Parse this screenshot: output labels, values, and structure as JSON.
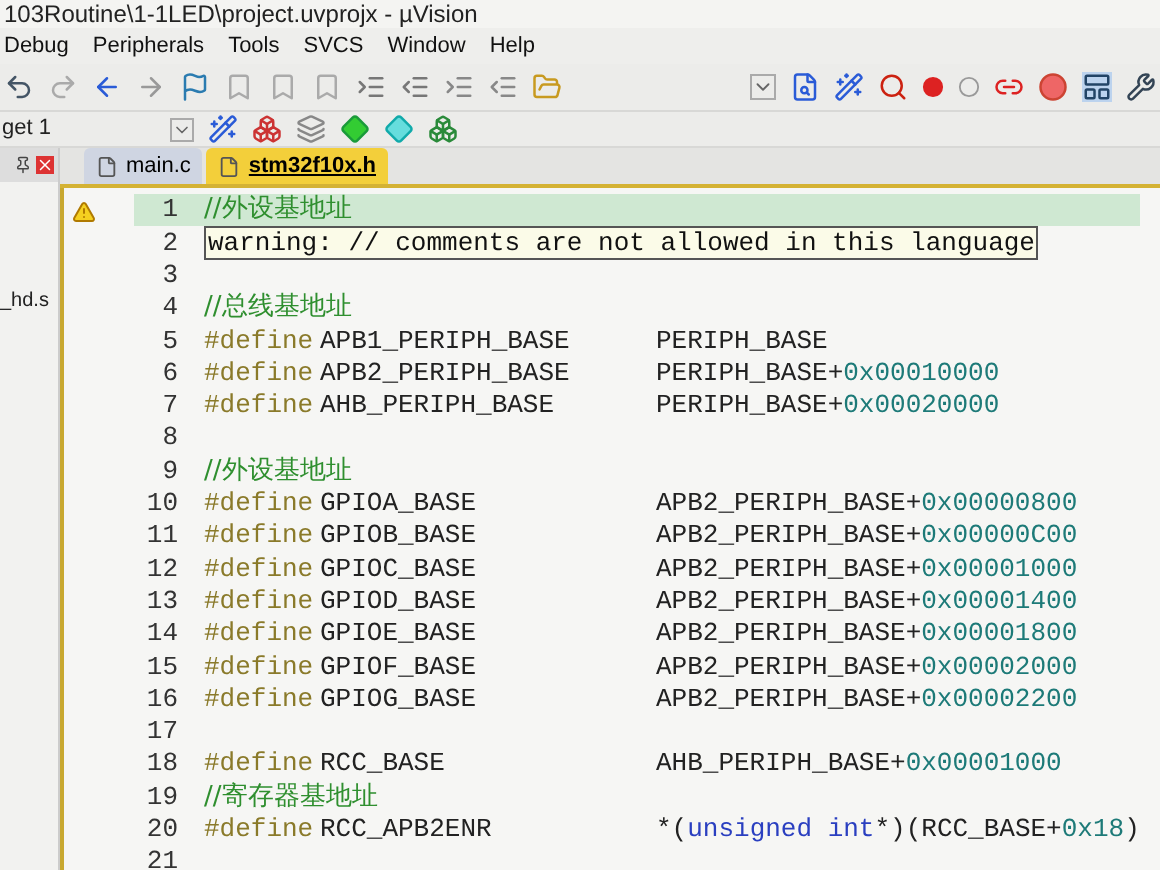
{
  "window": {
    "title": "103Routine\\1-1LED\\project.uvprojx - µVision"
  },
  "menu": [
    {
      "label": "Debug"
    },
    {
      "label": "Peripherals"
    },
    {
      "label": "Tools"
    },
    {
      "label": "SVCS"
    },
    {
      "label": "Window"
    },
    {
      "label": "Help"
    }
  ],
  "target": {
    "value": "get 1"
  },
  "project_panel": {
    "items": [
      {
        "label": "_hd.s"
      }
    ]
  },
  "tabs": [
    {
      "label": "main.c",
      "selected": false
    },
    {
      "label": "stm32f10x.h",
      "selected": true
    }
  ],
  "editor": {
    "lines": [
      {
        "number": "1",
        "kind": "comment",
        "current": true,
        "text": "//外设基地址"
      },
      {
        "number": "2",
        "kind": "warning",
        "current": false,
        "text": "warning: // comments are not allowed in this language"
      },
      {
        "number": "3",
        "kind": "blank",
        "current": false
      },
      {
        "number": "4",
        "kind": "comment",
        "current": false,
        "text": "//总线基地址"
      },
      {
        "number": "5",
        "kind": "define",
        "current": false,
        "directive": "#define",
        "name": "APB1_PERIPH_BASE",
        "value": [
          {
            "kind": "ident",
            "text": "PERIPH_BASE"
          }
        ]
      },
      {
        "number": "6",
        "kind": "define",
        "current": false,
        "directive": "#define",
        "name": "APB2_PERIPH_BASE",
        "value": [
          {
            "kind": "ident",
            "text": "PERIPH_BASE+"
          },
          {
            "kind": "number",
            "text": "0x00010000"
          }
        ]
      },
      {
        "number": "7",
        "kind": "define",
        "current": false,
        "directive": "#define",
        "name": "AHB_PERIPH_BASE",
        "value": [
          {
            "kind": "ident",
            "text": "PERIPH_BASE+"
          },
          {
            "kind": "number",
            "text": "0x00020000"
          }
        ]
      },
      {
        "number": "8",
        "kind": "blank",
        "current": false
      },
      {
        "number": "9",
        "kind": "comment",
        "current": false,
        "text": "//外设基地址"
      },
      {
        "number": "10",
        "kind": "define",
        "current": false,
        "directive": "#define",
        "name": "GPIOA_BASE",
        "value": [
          {
            "kind": "ident",
            "text": "APB2_PERIPH_BASE+"
          },
          {
            "kind": "number",
            "text": "0x00000800"
          }
        ]
      },
      {
        "number": "11",
        "kind": "define",
        "current": false,
        "directive": "#define",
        "name": "GPIOB_BASE",
        "value": [
          {
            "kind": "ident",
            "text": "APB2_PERIPH_BASE+"
          },
          {
            "kind": "number",
            "text": "0x00000C00"
          }
        ]
      },
      {
        "number": "12",
        "kind": "define",
        "current": false,
        "directive": "#define",
        "name": "GPIOC_BASE",
        "value": [
          {
            "kind": "ident",
            "text": "APB2_PERIPH_BASE+"
          },
          {
            "kind": "number",
            "text": "0x00001000"
          }
        ]
      },
      {
        "number": "13",
        "kind": "define",
        "current": false,
        "directive": "#define",
        "name": "GPIOD_BASE",
        "value": [
          {
            "kind": "ident",
            "text": "APB2_PERIPH_BASE+"
          },
          {
            "kind": "number",
            "text": "0x00001400"
          }
        ]
      },
      {
        "number": "14",
        "kind": "define",
        "current": false,
        "directive": "#define",
        "name": "GPIOE_BASE",
        "value": [
          {
            "kind": "ident",
            "text": "APB2_PERIPH_BASE+"
          },
          {
            "kind": "number",
            "text": "0x00001800"
          }
        ]
      },
      {
        "number": "15",
        "kind": "define",
        "current": false,
        "directive": "#define",
        "name": "GPIOF_BASE",
        "value": [
          {
            "kind": "ident",
            "text": "APB2_PERIPH_BASE+"
          },
          {
            "kind": "number",
            "text": "0x00002000"
          }
        ]
      },
      {
        "number": "16",
        "kind": "define",
        "current": false,
        "directive": "#define",
        "name": "GPIOG_BASE",
        "value": [
          {
            "kind": "ident",
            "text": "APB2_PERIPH_BASE+"
          },
          {
            "kind": "number",
            "text": "0x00002200"
          }
        ]
      },
      {
        "number": "17",
        "kind": "blank",
        "current": false
      },
      {
        "number": "18",
        "kind": "define",
        "current": false,
        "directive": "#define",
        "name": "RCC_BASE",
        "value": [
          {
            "kind": "ident",
            "text": "AHB_PERIPH_BASE+"
          },
          {
            "kind": "number",
            "text": "0x00001000"
          }
        ]
      },
      {
        "number": "19",
        "kind": "comment",
        "current": false,
        "text": "//寄存器基地址"
      },
      {
        "number": "20",
        "kind": "define",
        "current": false,
        "directive": "#define",
        "name": "RCC_APB2ENR",
        "value": [
          {
            "kind": "ident",
            "text": "*("
          },
          {
            "kind": "keyword",
            "text": "unsigned int"
          },
          {
            "kind": "ident",
            "text": "*)(RCC_BASE+"
          },
          {
            "kind": "number",
            "text": "0x18"
          },
          {
            "kind": "ident",
            "text": ")"
          }
        ]
      },
      {
        "number": "21",
        "kind": "blank",
        "current": false
      }
    ]
  }
}
